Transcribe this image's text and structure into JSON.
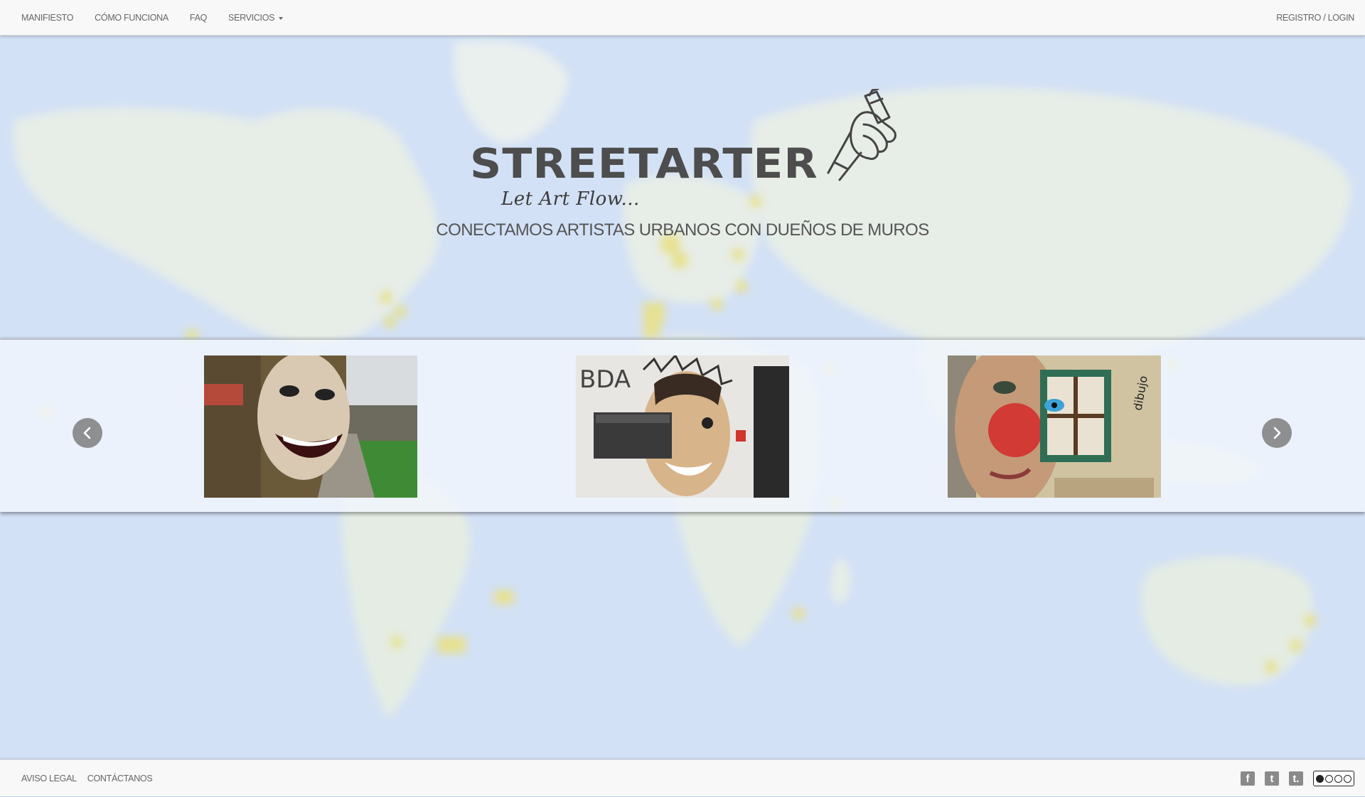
{
  "nav": {
    "items": [
      {
        "label": "MANIFIESTO"
      },
      {
        "label": "CÓMO FUNCIONA"
      },
      {
        "label": "FAQ"
      },
      {
        "label": "SERVICIOS"
      }
    ],
    "login": "REGISTRO / LOGIN"
  },
  "hero": {
    "logo_text": "STREETARTER",
    "tagline": "Let Art Flow...",
    "subtitle": "CONECTAMOS ARTISTAS URBANOS CON DUEÑOS DE MUROS"
  },
  "footer": {
    "links": [
      {
        "label": "AVISO LEGAL"
      },
      {
        "label": "CONTÁCTANOS"
      }
    ],
    "social": [
      {
        "icon": "facebook-icon",
        "glyph": "f"
      },
      {
        "icon": "twitter-icon",
        "glyph": "t"
      },
      {
        "icon": "tumblr-icon",
        "glyph": "t."
      }
    ]
  },
  "colors": {
    "map_water": "#bfd3f0",
    "map_land": "#e4ead6",
    "marker": "#e3d43a",
    "nav_bg": "#f8f8f8",
    "text": "#666666"
  }
}
